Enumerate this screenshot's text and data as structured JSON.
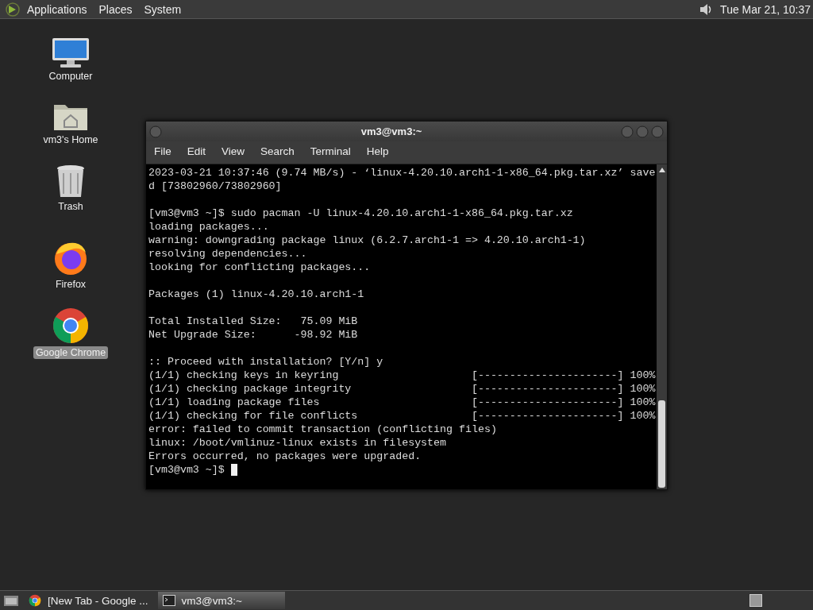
{
  "top_panel": {
    "menus": [
      "Applications",
      "Places",
      "System"
    ],
    "clock": "Tue Mar 21, 10:37"
  },
  "desktop_icons": [
    {
      "kind": "computer",
      "label": "Computer",
      "selected": false
    },
    {
      "kind": "home",
      "label": "vm3's Home",
      "selected": false
    },
    {
      "kind": "trash",
      "label": "Trash",
      "selected": false
    },
    {
      "kind": "firefox",
      "label": "Firefox",
      "selected": false
    },
    {
      "kind": "chrome",
      "label": "Google Chrome",
      "selected": true
    }
  ],
  "window": {
    "title": "vm3@vm3:~",
    "menu": [
      "File",
      "Edit",
      "View",
      "Search",
      "Terminal",
      "Help"
    ]
  },
  "terminal": {
    "lines": [
      {
        "kind": "text",
        "text": "2023-03-21 10:37:46 (9.74 MB/s) - ‘linux-4.20.10.arch1-1-x86_64.pkg.tar.xz’ save"
      },
      {
        "kind": "text",
        "text": "d [73802960/73802960]"
      },
      {
        "kind": "blank"
      },
      {
        "kind": "text",
        "text": "[vm3@vm3 ~]$ sudo pacman -U linux-4.20.10.arch1-1-x86_64.pkg.tar.xz"
      },
      {
        "kind": "text",
        "text": "loading packages..."
      },
      {
        "kind": "text",
        "text": "warning: downgrading package linux (6.2.7.arch1-1 => 4.20.10.arch1-1)"
      },
      {
        "kind": "text",
        "text": "resolving dependencies..."
      },
      {
        "kind": "text",
        "text": "looking for conflicting packages..."
      },
      {
        "kind": "blank"
      },
      {
        "kind": "text",
        "text": "Packages (1) linux-4.20.10.arch1-1"
      },
      {
        "kind": "blank"
      },
      {
        "kind": "text",
        "text": "Total Installed Size:   75.09 MiB"
      },
      {
        "kind": "text",
        "text": "Net Upgrade Size:      -98.92 MiB"
      },
      {
        "kind": "blank"
      },
      {
        "kind": "text",
        "text": ":: Proceed with installation? [Y/n] y"
      },
      {
        "kind": "text",
        "text": "(1/1) checking keys in keyring                     [----------------------] 100%"
      },
      {
        "kind": "text",
        "text": "(1/1) checking package integrity                   [----------------------] 100%"
      },
      {
        "kind": "text",
        "text": "(1/1) loading package files                        [----------------------] 100%"
      },
      {
        "kind": "text",
        "text": "(1/1) checking for file conflicts                  [----------------------] 100%"
      },
      {
        "kind": "text",
        "text": "error: failed to commit transaction (conflicting files)"
      },
      {
        "kind": "text",
        "text": "linux: /boot/vmlinuz-linux exists in filesystem"
      },
      {
        "kind": "text",
        "text": "Errors occurred, no packages were upgraded."
      },
      {
        "kind": "prompt",
        "text": "[vm3@vm3 ~]$ "
      }
    ]
  },
  "taskbar": {
    "tasks": [
      {
        "kind": "chrome",
        "label": "[New Tab - Google ...",
        "selected": false
      },
      {
        "kind": "terminal",
        "label": "vm3@vm3:~",
        "selected": true
      }
    ]
  }
}
